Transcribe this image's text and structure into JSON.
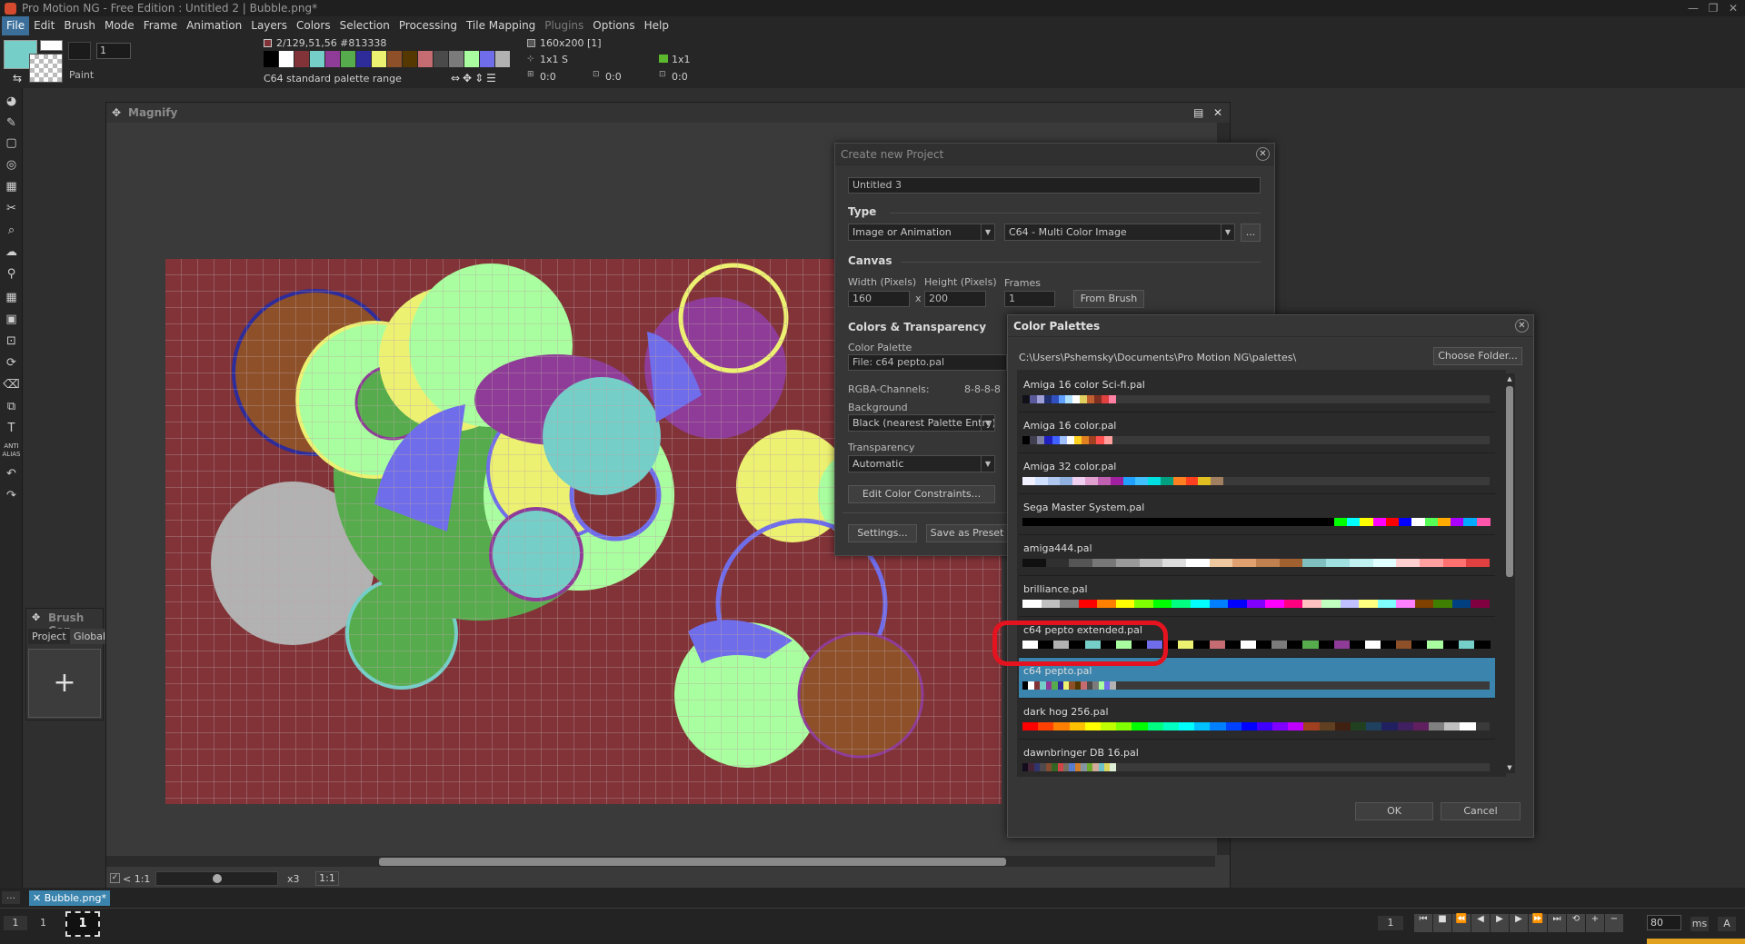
{
  "window": {
    "title": "Pro Motion NG - Free Edition : Untitled 2 | Bubble.png*",
    "min": "—",
    "max": "❐",
    "close": "✕"
  },
  "menu": [
    "File",
    "Edit",
    "Brush",
    "Mode",
    "Frame",
    "Animation",
    "Layers",
    "Colors",
    "Selection",
    "Processing",
    "Tile Mapping",
    "Plugins",
    "Options",
    "Help"
  ],
  "toolbar": {
    "paint_label": "Paint",
    "brush_size": "1",
    "color_info": "2/129,51,56 #813338",
    "palette_range": "C64 standard palette range",
    "image_size": "160x200 [1]",
    "brush_grid": "1x1 S",
    "coords_a": "0:0",
    "coords_b": "0:0",
    "zoom_a": "1x1",
    "coords_c": "0:0",
    "palette_colors": [
      "#000000",
      "#ffffff",
      "#813338",
      "#75cec8",
      "#8e3c97",
      "#56ac4d",
      "#2e2c9b",
      "#edf171",
      "#8e5029",
      "#553800",
      "#c46c71",
      "#4a4a4a",
      "#7b7b7b",
      "#a9ff9f",
      "#706deb",
      "#b2b2b2"
    ]
  },
  "magnify": {
    "title": "Magnify",
    "zoom_label": "x3",
    "ratio": "1:1",
    "ratio_small": "< 1:1"
  },
  "brush_container": {
    "title": "Brush Con",
    "tab_project": "Project",
    "tab_global": "Global",
    "add": "+"
  },
  "file_tab": "Bubble.png*",
  "status": {
    "left_a": "1",
    "left_b": "1",
    "frame": "1",
    "frame_right": "1",
    "speed": "80",
    "ms": "ms",
    "a": "A"
  },
  "create_project": {
    "title": "Create new Project",
    "name": "Untitled 3",
    "type_header": "Type",
    "type_value": "Image or Animation",
    "subtype_value": "C64 - Multi Color Image",
    "more": "...",
    "canvas_header": "Canvas",
    "width_label": "Width (Pixels)",
    "height_label": "Height (Pixels)",
    "frames_label": "Frames",
    "width": "160",
    "height": "200",
    "frames": "1",
    "times": "x",
    "from_brush": "From Brush",
    "colors_header": "Colors & Transparency",
    "palette_label": "Color Palette",
    "palette_value": "File: c64 pepto.pal",
    "rgba_label": "RGBA-Channels:",
    "rgba_value": "8-8-8-8",
    "background_label": "Background",
    "background_value": "Black (nearest Palette Entry)",
    "transparency_label": "Transparency",
    "transparency_value": "Automatic",
    "constraints": "Edit Color Constraints...",
    "settings": "Settings...",
    "save_preset": "Save as Preset"
  },
  "color_palettes": {
    "title": "Color Palettes",
    "path": "C:\\Users\\Pshemsky\\Documents\\Pro Motion NG\\palettes\\",
    "choose_folder": "Choose Folder...",
    "ok": "OK",
    "cancel": "Cancel",
    "items": [
      {
        "name": "Amiga 16 color Sci-fi.pal",
        "colors": [
          "#101018",
          "#5a5a9a",
          "#a0a0d8",
          "#203070",
          "#3050c0",
          "#60a0ff",
          "#b0e0ff",
          "#ffffff",
          "#e0d060",
          "#c06030",
          "#803020",
          "#e04040",
          "#ff80a0"
        ],
        "fill": 0.2
      },
      {
        "name": "Amiga 16 color.pal",
        "colors": [
          "#000000",
          "#404050",
          "#8080a0",
          "#2020c0",
          "#4060ff",
          "#a0c0ff",
          "#ffffff",
          "#ffd020",
          "#e08020",
          "#a04020",
          "#ff5050",
          "#ffa0a0"
        ],
        "fill": 0.19
      },
      {
        "name": "Amiga 32 color.pal",
        "colors": [
          "#f0f0ff",
          "#d0e0ff",
          "#b0c8f0",
          "#90b0e0",
          "#f0d0f0",
          "#e0a0d0",
          "#c060b0",
          "#a020a0",
          "#20a0ff",
          "#40c0ff",
          "#00e0e0",
          "#00a080",
          "#ff8020",
          "#ff4020",
          "#e0c020",
          "#a08060"
        ],
        "fill": 0.43
      },
      {
        "name": "Sega Master System.pal",
        "colors": [
          "#000000",
          "#000000",
          "#000000",
          "#000000",
          "#000000",
          "#000000",
          "#000000",
          "#000000",
          "#000000",
          "#000000",
          "#000000",
          "#000000",
          "#000000",
          "#000000",
          "#000000",
          "#000000",
          "#000000",
          "#000000",
          "#000000",
          "#000000",
          "#000000",
          "#000000",
          "#000000",
          "#000000",
          "#00ff00",
          "#00ffff",
          "#ffff00",
          "#ff00ff",
          "#ff0000",
          "#0000ff",
          "#ffffff",
          "#55ff55",
          "#ffaa00",
          "#aa00ff",
          "#00aaff",
          "#ff55aa"
        ],
        "fill": 1.0
      },
      {
        "name": "amiga444.pal",
        "colors": [
          "#101010",
          "#303030",
          "#555555",
          "#777777",
          "#999999",
          "#bbbbbb",
          "#dddddd",
          "#ffffff",
          "#f0c8a0",
          "#e0a070",
          "#c08050",
          "#a06030",
          "#80c0c0",
          "#a0e0e0",
          "#c0f0f0",
          "#e0ffff",
          "#ffd0d0",
          "#ffa0a0",
          "#ff7070",
          "#e04040"
        ],
        "fill": 1.0
      },
      {
        "name": "brilliance.pal",
        "colors": [
          "#ffffff",
          "#c0c0c0",
          "#808080",
          "#ff0000",
          "#ff8000",
          "#ffff00",
          "#80ff00",
          "#00ff00",
          "#00ff80",
          "#00ffff",
          "#0080ff",
          "#0000ff",
          "#8000ff",
          "#ff00ff",
          "#ff0080",
          "#ffc0c0",
          "#c0ffc0",
          "#c0c0ff",
          "#ffff80",
          "#80ffff",
          "#ff80ff",
          "#804000",
          "#408000",
          "#004080",
          "#800040"
        ],
        "fill": 1.0
      },
      {
        "name": "c64 pepto extended.pal",
        "colors": [
          "#ffffff",
          "#000000",
          "#b2b2b2",
          "#000000",
          "#75cec8",
          "#000000",
          "#a9ff9f",
          "#000000",
          "#706deb",
          "#000000",
          "#edf171",
          "#000000",
          "#c46c71",
          "#000000",
          "#ffffff",
          "#000000",
          "#7b7b7b",
          "#000000",
          "#56ac4d",
          "#000000",
          "#8e3c97",
          "#000000",
          "#ffffff",
          "#000000",
          "#8e5029",
          "#000000",
          "#a9ff9f",
          "#000000",
          "#75cec8",
          "#000000"
        ],
        "fill": 1.0
      },
      {
        "name": "c64 pepto.pal",
        "colors": [
          "#000000",
          "#ffffff",
          "#813338",
          "#75cec8",
          "#8e3c97",
          "#56ac4d",
          "#2e2c9b",
          "#edf171",
          "#8e5029",
          "#553800",
          "#c46c71",
          "#4a4a4a",
          "#7b7b7b",
          "#a9ff9f",
          "#706deb",
          "#b2b2b2"
        ],
        "fill": 0.2
      },
      {
        "name": "dark hog 256.pal",
        "colors": [
          "#ff0000",
          "#ff4000",
          "#ff8000",
          "#ffc000",
          "#ffff00",
          "#c0ff00",
          "#80ff00",
          "#00ff00",
          "#00ff80",
          "#00ffc0",
          "#00ffff",
          "#00c0ff",
          "#0080ff",
          "#0040ff",
          "#0000ff",
          "#4000ff",
          "#8000ff",
          "#c000ff",
          "#a04020",
          "#604020",
          "#402010",
          "#204020",
          "#204060",
          "#202060",
          "#402060",
          "#602060",
          "#808080",
          "#c0c0c0",
          "#ffffff"
        ],
        "fill": 0.97
      },
      {
        "name": "dawnbringer DB 16.pal",
        "colors": [
          "#140c1c",
          "#442434",
          "#30346d",
          "#4e4a4e",
          "#854c30",
          "#346524",
          "#d04648",
          "#757161",
          "#597dce",
          "#d27d2c",
          "#8595a1",
          "#6daa2c",
          "#d2aa99",
          "#6dc2ca",
          "#dad45e",
          "#deeed6"
        ],
        "fill": 0.2
      }
    ]
  }
}
